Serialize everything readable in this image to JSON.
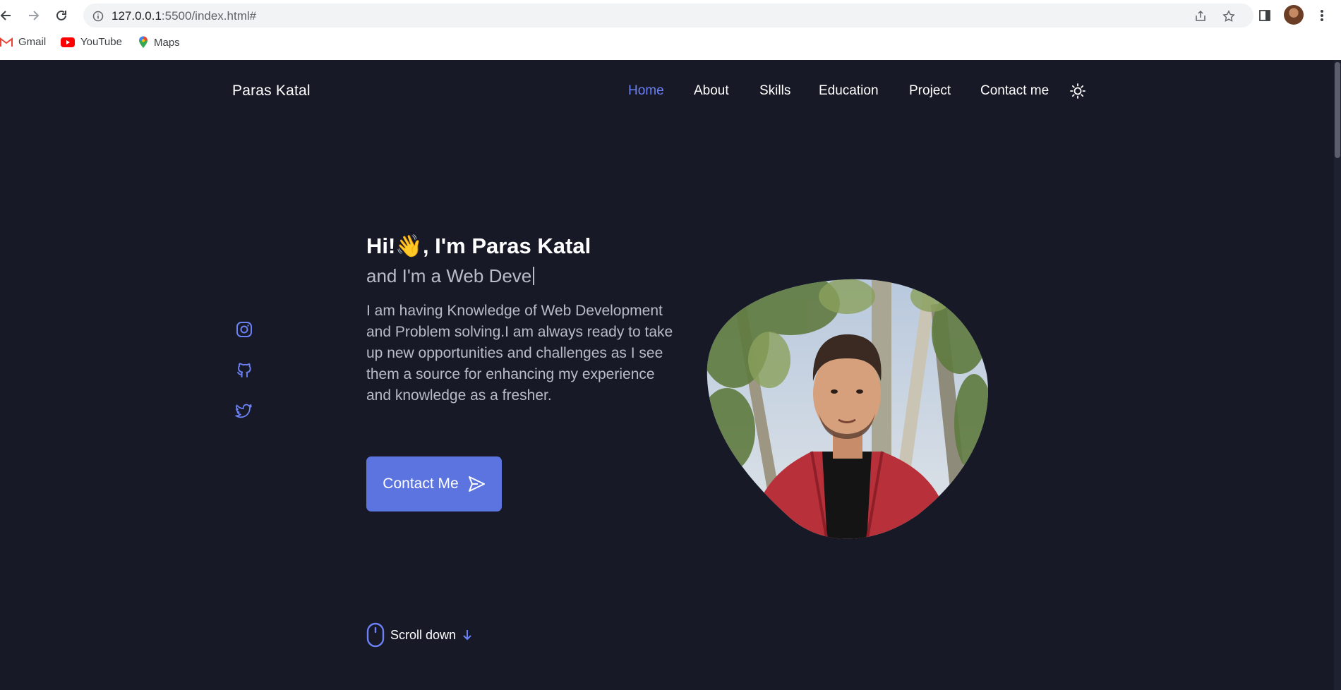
{
  "browser": {
    "url_host": "127.0.0.1",
    "url_path": ":5500/index.html#",
    "bookmarks": [
      {
        "label": "Gmail",
        "icon": "gmail-icon"
      },
      {
        "label": "YouTube",
        "icon": "youtube-icon"
      },
      {
        "label": "Maps",
        "icon": "maps-icon"
      }
    ]
  },
  "header": {
    "brand": "Paras Katal",
    "nav": [
      "Home",
      "About",
      "Skills",
      "Education",
      "Project",
      "Contact me"
    ],
    "active": "Home"
  },
  "hero": {
    "greeting_prefix": "Hi!",
    "greeting_emoji": "👋",
    "greeting_suffix": ", I'm Paras Katal",
    "role": "and I'm a Web Deve",
    "description": "I am having Knowledge of Web Development and Problem solving.I am always ready to take up new opportunities and challenges as I see them a source for enhancing my experience and knowledge as a fresher.",
    "cta_label": "Contact Me",
    "scroll_label": "Scroll down"
  },
  "social": [
    "instagram-icon",
    "github-icon",
    "twitter-icon"
  ],
  "colors": {
    "background": "#171a26",
    "accent": "#5b74df",
    "accent_light": "#6b80f5",
    "text_muted": "#b9bcc8"
  }
}
